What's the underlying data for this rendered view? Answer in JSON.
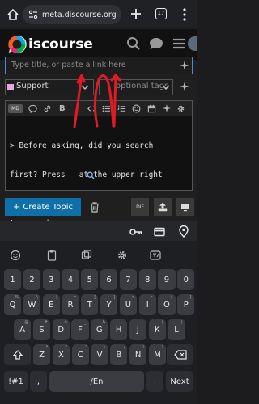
{
  "browser": {
    "url": "meta.discourse.org",
    "tab_count": "17"
  },
  "header": {
    "brand_text": "iscourse"
  },
  "composer": {
    "title_placeholder": "Type title, or paste a link here",
    "category": "Support",
    "category_color": "#e9a6df",
    "tags_placeholder": "optional tags",
    "toolbar_toggle": "MD",
    "toolbar": [
      "quote-icon",
      "link-icon",
      "bold-icon",
      "italic-icon",
      "code-icon",
      "list-icon",
      "numbered-list-icon",
      "emoji-icon",
      "calendar-icon",
      "sparkle-icon",
      "gear-icon"
    ],
    "body_lines": [
      "> Before asking, did you search",
      "first? Press   at the upper right",
      "to search."
    ],
    "create_label": "Create Topic",
    "diff_label": "DIF"
  },
  "keyboard": {
    "row_numbers": [
      "1",
      "2",
      "3",
      "4",
      "5",
      "6",
      "7",
      "8",
      "9",
      "0"
    ],
    "row1": [
      {
        "k": "Q",
        "s": "%"
      },
      {
        "k": "W",
        "s": "\\"
      },
      {
        "k": "E",
        "s": "|"
      },
      {
        "k": "R",
        "s": "="
      },
      {
        "k": "T",
        "s": "["
      },
      {
        "k": "Y",
        "s": "]"
      },
      {
        "k": "U",
        "s": "<"
      },
      {
        "k": "I",
        "s": ">"
      },
      {
        "k": "O",
        "s": "{"
      },
      {
        "k": "P",
        "s": "}"
      }
    ],
    "row2": [
      {
        "k": "A",
        "s": "@"
      },
      {
        "k": "S",
        "s": "#"
      },
      {
        "k": "D",
        "s": "$"
      },
      {
        "k": "F",
        "s": "_"
      },
      {
        "k": "G",
        "s": "&"
      },
      {
        "k": "H",
        "s": "-"
      },
      {
        "k": "J",
        "s": "+"
      },
      {
        "k": "K",
        "s": "("
      },
      {
        "k": "L",
        "s": ")"
      }
    ],
    "row3": [
      {
        "k": "Z",
        "s": "*"
      },
      {
        "k": "X",
        "s": "\""
      },
      {
        "k": "C",
        "s": "'"
      },
      {
        "k": "V",
        "s": ":"
      },
      {
        "k": "B",
        "s": ";"
      },
      {
        "k": "N",
        "s": "!"
      },
      {
        "k": "M",
        "s": "?"
      }
    ],
    "sym_label": "!#1",
    "comma": ",",
    "lang_label": "/En",
    "period": ".",
    "next_label": "Next"
  },
  "colors": {
    "accent": "#0f6fa8",
    "focus_border": "#4b8bd6",
    "annotation_red": "#e01b24"
  }
}
